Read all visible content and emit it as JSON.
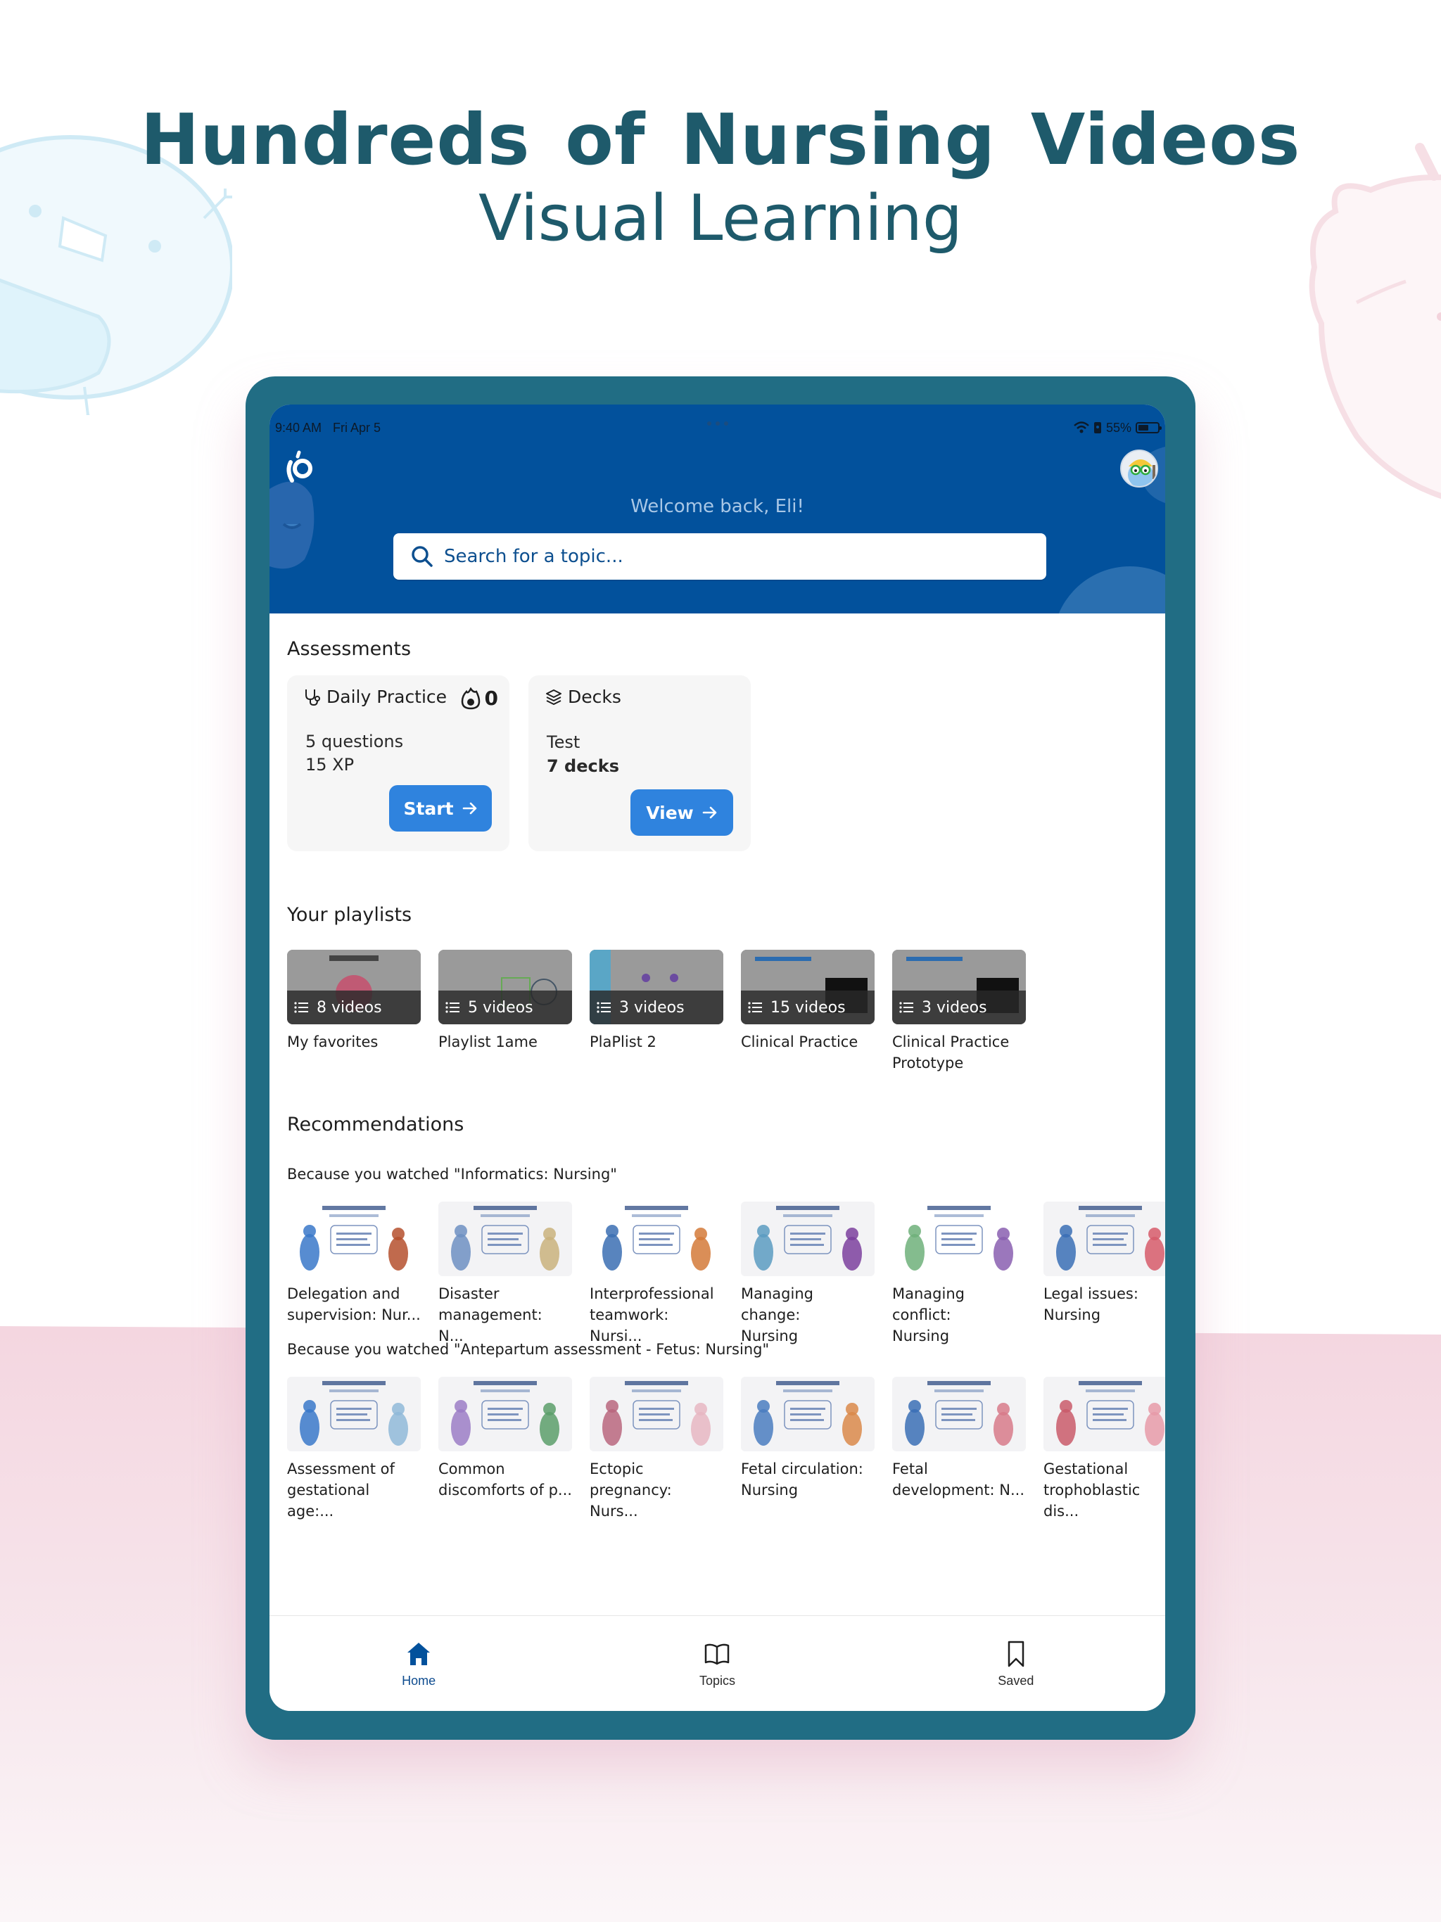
{
  "hero": {
    "title": "Hundreds of  Nursing Videos",
    "subtitle": "Visual Learning"
  },
  "colors": {
    "hero_text": "#1e5a6b",
    "tablet_frame": "#216d84",
    "header_bg": "#02519c",
    "primary_button": "#2f83de",
    "active_tab": "#0e4c8f",
    "page_pink": "#f4d6e0"
  },
  "status_bar": {
    "time": "9:40 AM",
    "date": "Fri Apr 5",
    "battery_percent": "55%",
    "battery_level": 0.55
  },
  "header": {
    "logo_icon": "osmosis-logo-icon",
    "avatar_icon": "mascot-avatar",
    "welcome": "Welcome back, Eli!",
    "search_placeholder": "Search for a topic..."
  },
  "assessments": {
    "title": "Assessments",
    "daily": {
      "title": "Daily Practice",
      "icon": "stethoscope-icon",
      "streak_icon": "flame-icon",
      "streak": "0",
      "line1": "5 questions",
      "line2": "15 XP",
      "button": "Start"
    },
    "decks": {
      "title": "Decks",
      "icon": "layers-icon",
      "line1": "Test",
      "line2": "7 decks",
      "button": "View"
    }
  },
  "playlists": {
    "title": "Your playlists",
    "items": [
      {
        "count": "8 videos",
        "name": "My favorites"
      },
      {
        "count": "5 videos",
        "name": "Playlist 1ame"
      },
      {
        "count": "3 videos",
        "name": "PlaPlist 2"
      },
      {
        "count": "15 videos",
        "name": "Clinical Practice"
      },
      {
        "count": "3 videos",
        "name": "Clinical Practice Prototype"
      }
    ]
  },
  "recommendations": {
    "title": "Recommendations",
    "groups": [
      {
        "heading": "Because you watched \"Informatics: Nursing\"",
        "items": [
          {
            "line1": "Delegation and",
            "line2": "supervision: Nur..."
          },
          {
            "line1": "Disaster",
            "line2": "management: N..."
          },
          {
            "line1": "Interprofessional",
            "line2": "teamwork: Nursi..."
          },
          {
            "line1": "Managing change:",
            "line2": "Nursing"
          },
          {
            "line1": "Managing conflict:",
            "line2": "Nursing"
          },
          {
            "line1": "Legal issues:",
            "line2": "Nursing"
          }
        ]
      },
      {
        "heading": "Because you watched \"Antepartum assessment - Fetus: Nursing\"",
        "items": [
          {
            "line1": "Assessment of",
            "line2": "gestational age:..."
          },
          {
            "line1": "Common",
            "line2": "discomforts of p..."
          },
          {
            "line1": "Ectopic",
            "line2": "pregnancy: Nurs..."
          },
          {
            "line1": "Fetal circulation:",
            "line2": "Nursing"
          },
          {
            "line1": "Fetal",
            "line2": "development: N..."
          },
          {
            "line1": "Gestational",
            "line2": "trophoblastic dis..."
          }
        ]
      }
    ]
  },
  "tabbar": {
    "tabs": [
      {
        "label": "Home",
        "icon": "home-icon",
        "active": true
      },
      {
        "label": "Topics",
        "icon": "book-icon",
        "active": false
      },
      {
        "label": "Saved",
        "icon": "bookmark-icon",
        "active": false
      }
    ]
  }
}
